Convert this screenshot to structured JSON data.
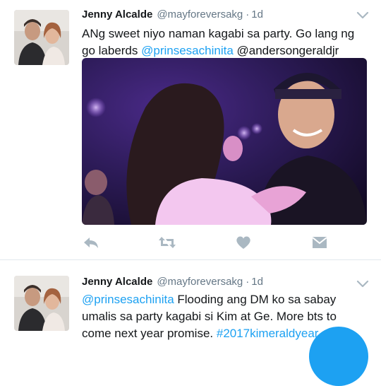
{
  "tweets": [
    {
      "author_name": "Jenny Alcalde",
      "handle": "@mayforeversakg",
      "separator": "·",
      "time": "1d",
      "text_segments": [
        {
          "text": "ANg sweet niyo naman kagabi sa party. Go lang ng go laberds ",
          "type": "plain"
        },
        {
          "text": "@prinsesachinita",
          "type": "mention"
        },
        {
          "text": " @andersongeraldjr",
          "type": "plain"
        }
      ],
      "has_media": true,
      "actions": [
        "reply-icon",
        "retweet-icon",
        "like-icon",
        "direct-message-icon"
      ]
    },
    {
      "author_name": "Jenny Alcalde",
      "handle": "@mayforeversakg",
      "separator": "·",
      "time": "1d",
      "text_segments": [
        {
          "text": "@prinsesachinita",
          "type": "mention"
        },
        {
          "text": " Flooding ang DM ko sa sabay umalis sa party kagabi si Kim at Ge. More bts to come next year promise. ",
          "type": "plain"
        },
        {
          "text": "#2017kimeraldyear",
          "type": "hashtag"
        }
      ]
    }
  ],
  "colors": {
    "accent": "#1da1f2",
    "text": "#14171a",
    "muted": "#657786",
    "icon": "#aab8c2"
  }
}
